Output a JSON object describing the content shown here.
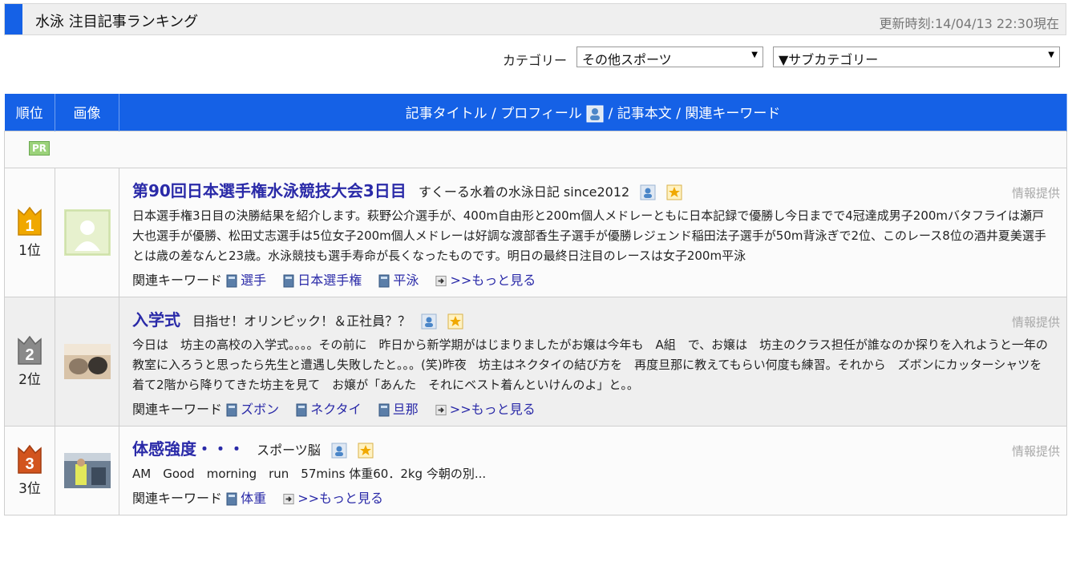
{
  "header": {
    "title": "水泳 注目記事ランキング",
    "updated": "更新時刻:14/04/13 22:30現在"
  },
  "filters": {
    "category_label": "カテゴリー",
    "category_value": "その他スポーツ",
    "subcategory_value": "▼サブカテゴリー"
  },
  "table": {
    "col_rank": "順位",
    "col_image": "画像",
    "col_main_1": "記事タイトル / プロフィール",
    "col_main_2": "/ 記事本文 / 関連キーワード",
    "pr": "PR",
    "keywords_label": "関連キーワード",
    "more": ">>もっと見る",
    "provided": "情報提供"
  },
  "entries": [
    {
      "rank": "1位",
      "rank_color": "#f0a800",
      "title": "第90回日本選手権水泳競技大会3日目",
      "source": "すくーる水着の水泳日記 since2012",
      "body": "日本選手権3日目の決勝結果を紹介します。萩野公介選手が、400m自由形と200m個人メドレーともに日本記録で優勝し今日までで4冠達成男子200mバタフライは瀬戸大也選手が優勝、松田丈志選手は5位女子200m個人メドレーは好調な渡部香生子選手が優勝レジェンド稲田法子選手が50m背泳ぎで2位、このレース8位の酒井夏美選手とは歳の差なんと23歳。水泳競技も選手寿命が長くなったものです。明日の最終日注目のレースは女子200m平泳",
      "keywords": [
        "選手",
        "日本選手権",
        "平泳"
      ]
    },
    {
      "rank": "2位",
      "rank_color": "#8a8a8a",
      "title": "入学式",
      "source": "目指せ！オリンピック！＆正社員？？",
      "body": "今日は　坊主の高校の入学式。。。。その前に　昨日から新学期がはじまりましたがお嬢は今年も　A組　で、お嬢は　坊主のクラス担任が誰なのか探りを入れようと一年の教室に入ろうと思ったら先生と遭遇し失敗したと。。。(笑)昨夜　坊主はネクタイの結び方を　再度旦那に教えてもらい何度も練習。それから　ズボンにカッターシャツを着て2階から降りてきた坊主を見て　お嬢が「あんた　それにベスト着んといけんのよ」と。。",
      "keywords": [
        "ズボン",
        "ネクタイ",
        "旦那"
      ]
    },
    {
      "rank": "3位",
      "rank_color": "#d2541e",
      "title": "体感強度・・・",
      "source": "スポーツ脳",
      "body": "AM　Good　morning　run　57mins 体重60．2kg 今朝の別...",
      "keywords": [
        "体重"
      ]
    }
  ]
}
